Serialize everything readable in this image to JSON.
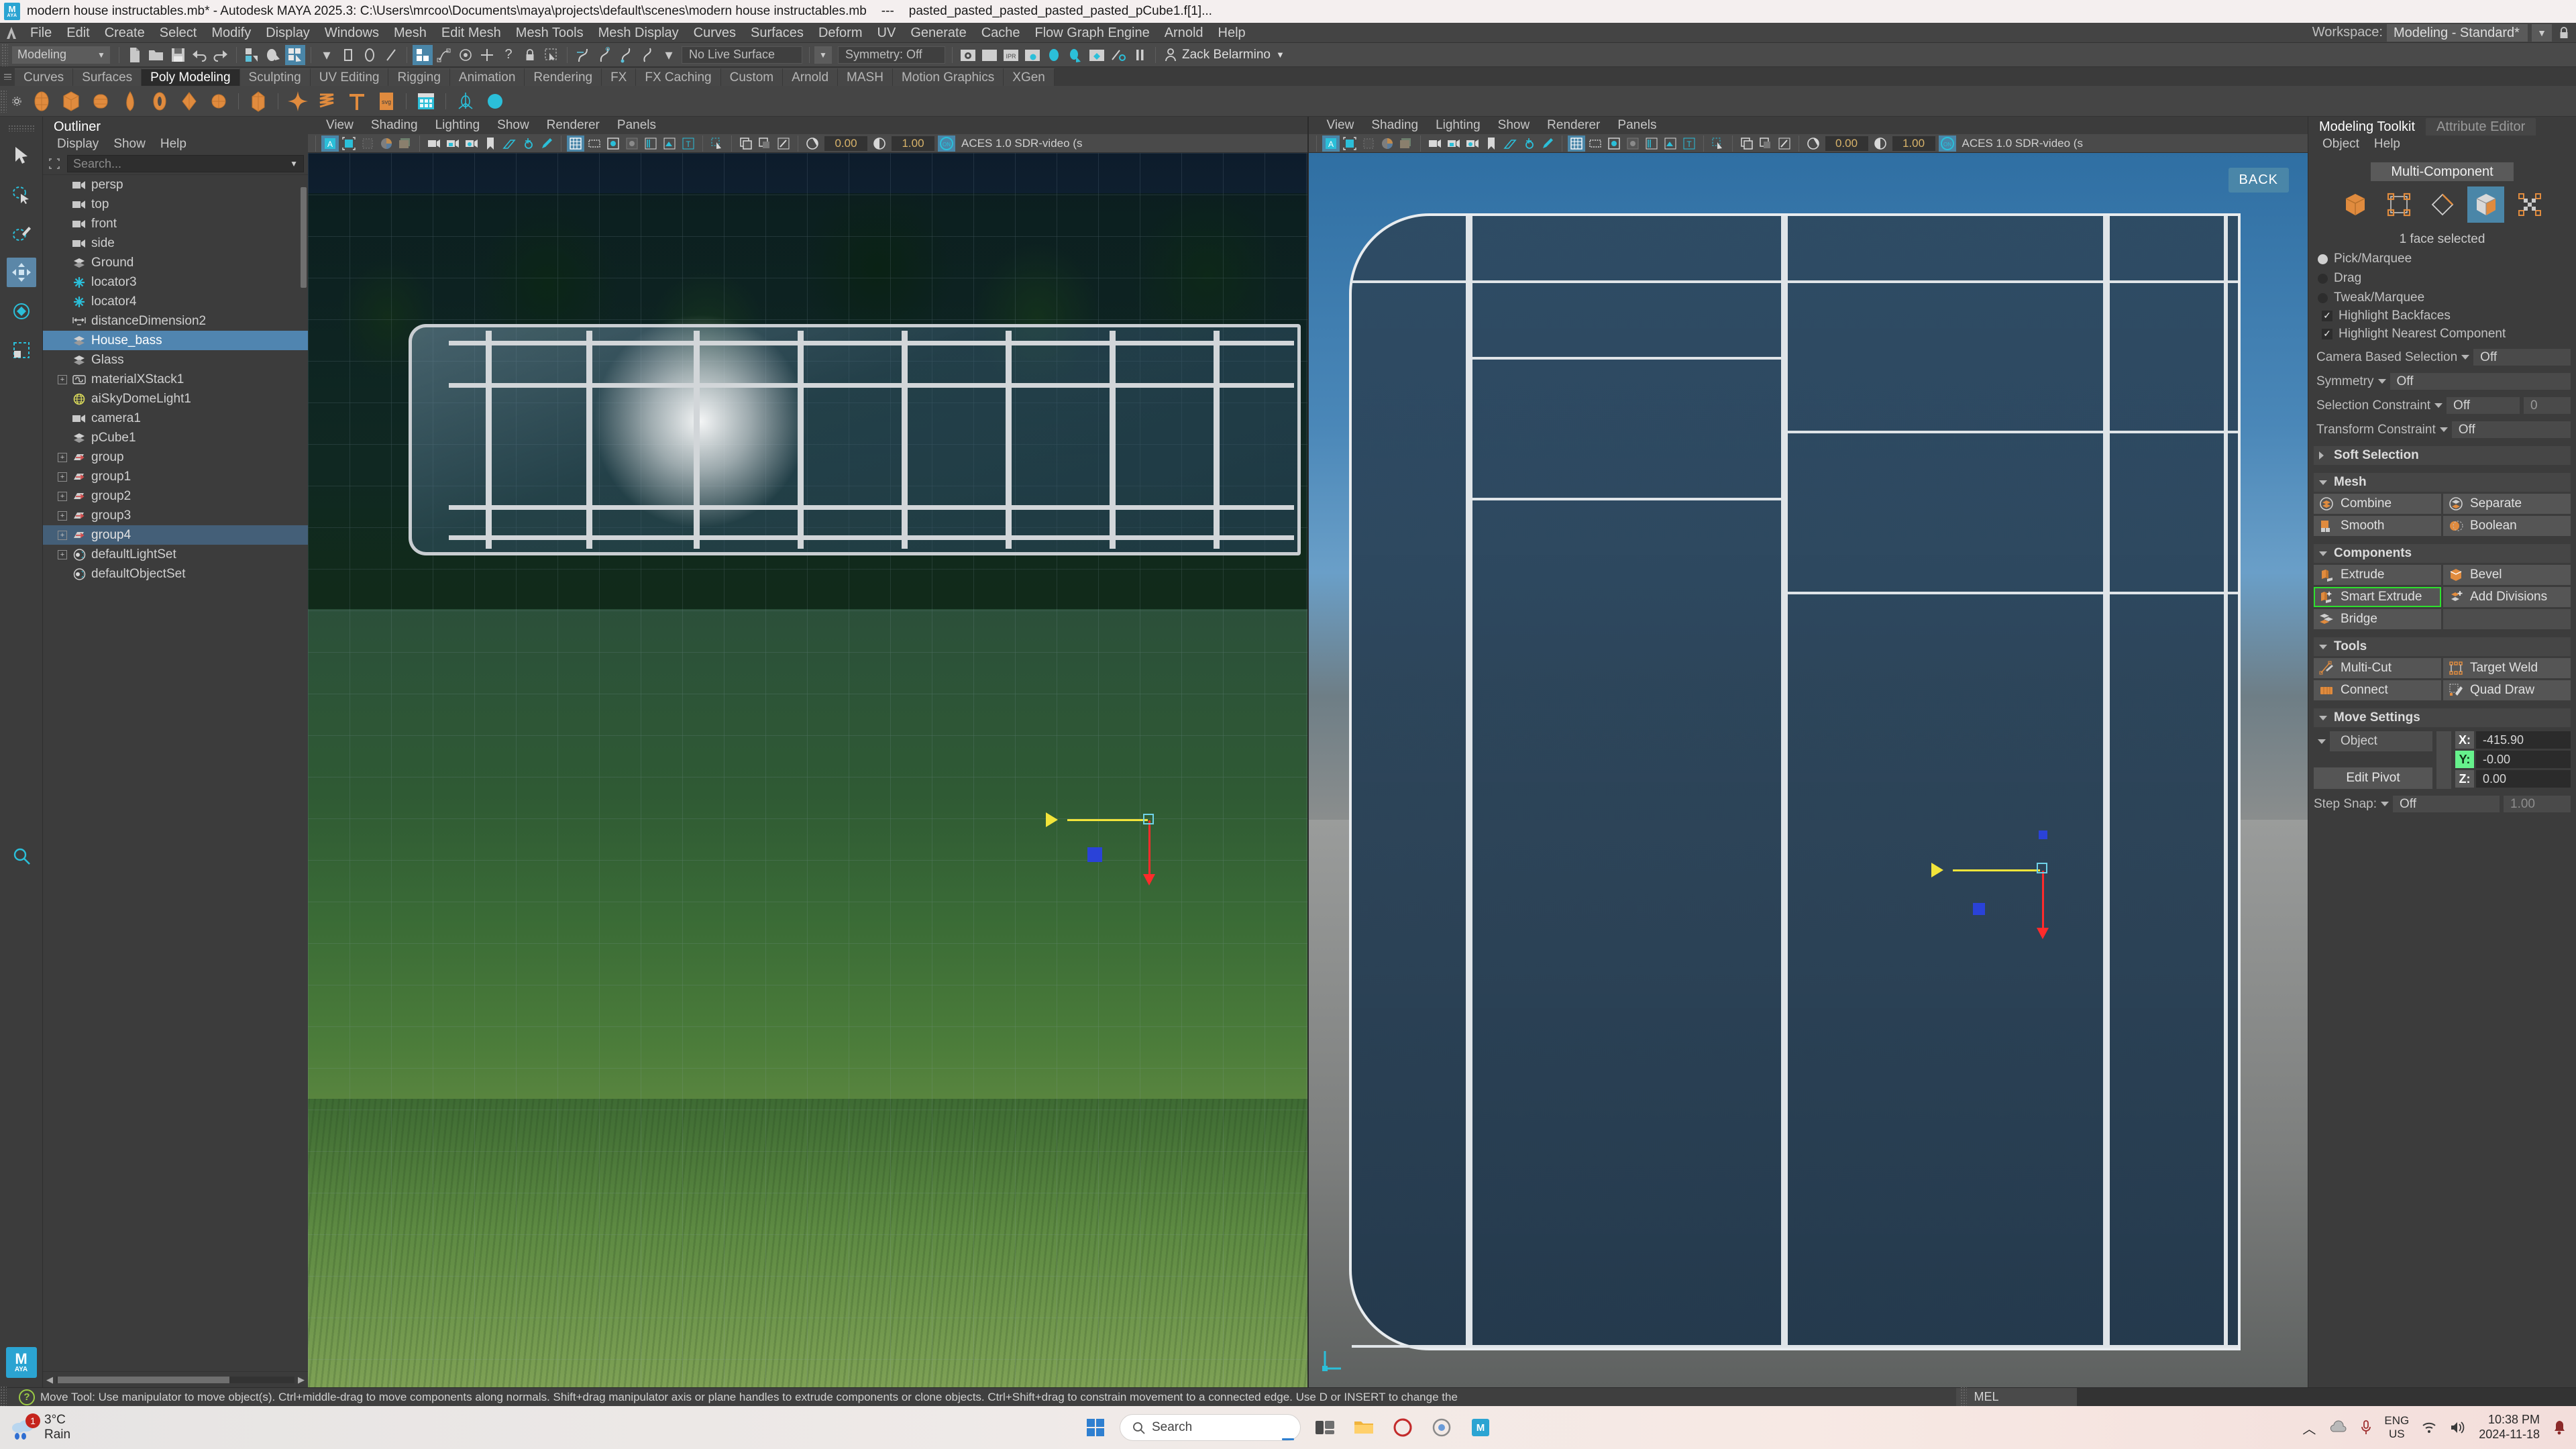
{
  "titlebar": {
    "text": "modern house instructables.mb* - Autodesk MAYA 2025.3: C:\\Users\\mrcoo\\Documents\\maya\\projects\\default\\scenes\\modern house instructables.mb",
    "separator": "---",
    "selection": "pasted_pasted_pasted_pasted_pasted_pCube1.f[1]...",
    "app_icon": "maya-logo-icon"
  },
  "menubar": {
    "items": [
      "File",
      "Edit",
      "Create",
      "Select",
      "Modify",
      "Display",
      "Windows",
      "Mesh",
      "Edit Mesh",
      "Mesh Tools",
      "Mesh Display",
      "Curves",
      "Surfaces",
      "Deform",
      "UV",
      "Generate",
      "Cache",
      "Flow Graph Engine",
      "Arnold",
      "Help"
    ],
    "workspace_label": "Workspace:",
    "workspace_value": "Modeling - Standard*"
  },
  "statusline": {
    "menu_set": "Modeling",
    "live_surface": "No Live Surface",
    "symmetry": "Symmetry: Off",
    "user": "Zack Belarmino"
  },
  "shelf": {
    "tabs": [
      "Curves",
      "Surfaces",
      "Poly Modeling",
      "Sculpting",
      "UV Editing",
      "Rigging",
      "Animation",
      "Rendering",
      "FX",
      "FX Caching",
      "Custom",
      "Arnold",
      "MASH",
      "Motion Graphics",
      "XGen"
    ],
    "active_tab": "Poly Modeling"
  },
  "outliner": {
    "tab": "Outliner",
    "menus": [
      "Display",
      "Show",
      "Help"
    ],
    "search_placeholder": "Search...",
    "items": [
      {
        "label": "persp",
        "icon": "camera-icon",
        "expand": false,
        "state": "normal"
      },
      {
        "label": "top",
        "icon": "camera-icon",
        "expand": false,
        "state": "normal"
      },
      {
        "label": "front",
        "icon": "camera-icon",
        "expand": false,
        "state": "normal"
      },
      {
        "label": "side",
        "icon": "camera-icon",
        "expand": false,
        "state": "normal"
      },
      {
        "label": "Ground",
        "icon": "mesh-icon",
        "expand": false,
        "state": "normal"
      },
      {
        "label": "locator3",
        "icon": "locator-icon",
        "expand": false,
        "state": "normal"
      },
      {
        "label": "locator4",
        "icon": "locator-icon",
        "expand": false,
        "state": "normal"
      },
      {
        "label": "distanceDimension2",
        "icon": "distance-icon",
        "expand": false,
        "state": "normal"
      },
      {
        "label": "House_bass",
        "icon": "mesh-icon",
        "expand": false,
        "state": "selected"
      },
      {
        "label": "Glass",
        "icon": "mesh-icon",
        "expand": false,
        "state": "normal"
      },
      {
        "label": "materialXStack1",
        "icon": "materialx-icon",
        "expand": true,
        "state": "normal"
      },
      {
        "label": "aiSkyDomeLight1",
        "icon": "skydome-icon",
        "expand": false,
        "state": "normal"
      },
      {
        "label": "camera1",
        "icon": "camera-icon",
        "expand": false,
        "state": "normal"
      },
      {
        "label": "pCube1",
        "icon": "mesh-icon",
        "expand": false,
        "state": "normal"
      },
      {
        "label": "group",
        "icon": "group-icon",
        "expand": true,
        "state": "normal"
      },
      {
        "label": "group1",
        "icon": "group-icon",
        "expand": true,
        "state": "normal"
      },
      {
        "label": "group2",
        "icon": "group-icon",
        "expand": true,
        "state": "normal"
      },
      {
        "label": "group3",
        "icon": "group-icon",
        "expand": true,
        "state": "normal"
      },
      {
        "label": "group4",
        "icon": "group-icon",
        "expand": true,
        "state": "highlighted"
      },
      {
        "label": "defaultLightSet",
        "icon": "set-icon",
        "expand": true,
        "state": "normal"
      },
      {
        "label": "defaultObjectSet",
        "icon": "set-icon",
        "expand": false,
        "state": "normal"
      }
    ]
  },
  "viewport_left": {
    "menus": [
      "View",
      "Shading",
      "Lighting",
      "Show",
      "Renderer",
      "Panels"
    ],
    "exposure": "0.00",
    "gamma": "1.00",
    "color_space": "ACES 1.0 SDR-video (s"
  },
  "viewport_right": {
    "menus": [
      "View",
      "Shading",
      "Lighting",
      "Show",
      "Renderer",
      "Panels"
    ],
    "exposure": "0.00",
    "gamma": "1.00",
    "color_space": "ACES 1.0 SDR-video (s",
    "view_label": "BACK"
  },
  "modeling_toolkit": {
    "tabs": [
      "Modeling Toolkit",
      "Attribute Editor"
    ],
    "active_tab": "Modeling Toolkit",
    "menus": [
      "Object",
      "Help"
    ],
    "multi_component": "Multi-Component",
    "component_modes": [
      "object-mode-icon",
      "vertex-mode-icon",
      "edge-mode-icon",
      "face-mode-icon",
      "uv-mode-icon"
    ],
    "active_component_mode": 3,
    "selection_status": "1 face selected",
    "radios": [
      {
        "label": "Pick/Marquee",
        "on": true
      },
      {
        "label": "Drag",
        "on": false
      },
      {
        "label": "Tweak/Marquee",
        "on": false
      }
    ],
    "checkboxes": [
      {
        "label": "Highlight Backfaces",
        "checked": true
      },
      {
        "label": "Highlight Nearest Component",
        "checked": true
      }
    ],
    "properties": [
      {
        "label": "Camera Based Selection",
        "value": "Off",
        "extra": null
      },
      {
        "label": "Symmetry",
        "value": "Off",
        "extra": null
      },
      {
        "label": "Selection Constraint",
        "value": "Off",
        "extra": "0"
      },
      {
        "label": "Transform Constraint",
        "value": "Off",
        "extra": null
      }
    ],
    "sections": {
      "soft_selection": "Soft Selection",
      "mesh": "Mesh",
      "components": "Components",
      "tools": "Tools",
      "move_settings": "Move Settings"
    },
    "mesh_buttons": [
      "Combine",
      "Separate",
      "Smooth",
      "Boolean"
    ],
    "component_buttons": [
      "Extrude",
      "Bevel",
      "Smart Extrude",
      "Add Divisions",
      "Bridge"
    ],
    "highlighted_button": "Smart Extrude",
    "tool_buttons": [
      "Multi-Cut",
      "Target Weld",
      "Connect",
      "Quad Draw"
    ],
    "move_settings": {
      "space": "Object",
      "edit_pivot": "Edit Pivot",
      "axes": [
        {
          "label": "X:",
          "value": "-415.90",
          "active": false
        },
        {
          "label": "Y:",
          "value": "-0.00",
          "active": true
        },
        {
          "label": "Z:",
          "value": "0.00",
          "active": false
        }
      ],
      "step_snap_label": "Step Snap:",
      "step_snap_value": "Off",
      "step_snap_amount": "1.00"
    }
  },
  "statusbar": {
    "help": "Move Tool: Use manipulator to move object(s). Ctrl+middle-drag to move components along normals. Shift+drag manipulator axis or plane handles to extrude components or clone objects. Ctrl+Shift+drag to constrain movement to a connected edge. Use D or INSERT to change the",
    "command_lang": "MEL"
  },
  "taskbar": {
    "weather_temp": "3°C",
    "weather_desc": "Rain",
    "weather_badge": "1",
    "search_placeholder": "Search",
    "language": "ENG",
    "region": "US",
    "time": "10:38 PM",
    "date": "2024-11-18"
  },
  "colors": {
    "accent_blue": "#4a86a8",
    "selection_blue": "#5085b0",
    "maya_orange": "#e08b3e",
    "highlight_green": "#2ee02e",
    "axis_x": "#f2e43a",
    "axis_y": "#ff2b2b"
  }
}
